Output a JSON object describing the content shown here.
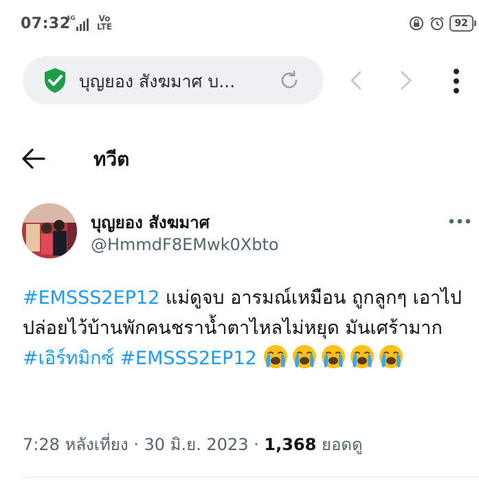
{
  "status_bar": {
    "time": "07:32",
    "network": "4G",
    "volte": "Vo LTE",
    "battery": "92"
  },
  "browser": {
    "url_text": "บุญยอง สังฆมาศ บ...",
    "colors": {
      "shield": "#1e9e4a",
      "pill": "#eef0f3"
    }
  },
  "page": {
    "title": "ทวีต"
  },
  "tweet": {
    "author_name": "บุญยอง สังฆมาศ",
    "author_handle": "@HmmdF8EMwk0Xbto",
    "segments": {
      "s1": "#EMSSS2EP12",
      "s2": " แม่ดูจบ อารมณ์เหมือน ถูกลูกๆ เอาไปปล่อยไว้บ้านพักคนชราน้ำตาไหลไม่หยุด มันเศร้ามาก ",
      "s3": "#เอิร์ทมิกซ์",
      "s4": " ",
      "s5": "#EMSSS2EP12",
      "s6": " "
    },
    "emoji": "loudly-crying-face",
    "emoji_count": 5,
    "time": "7:28 หลังเที่ยง",
    "sep1": " · ",
    "date": "30 มิ.ย. 2023",
    "sep2": " · ",
    "views_count": "1,368",
    "views_label": " ยอดดู",
    "colors": {
      "hashtag": "#1d9bf0",
      "handle": "#536471"
    }
  }
}
